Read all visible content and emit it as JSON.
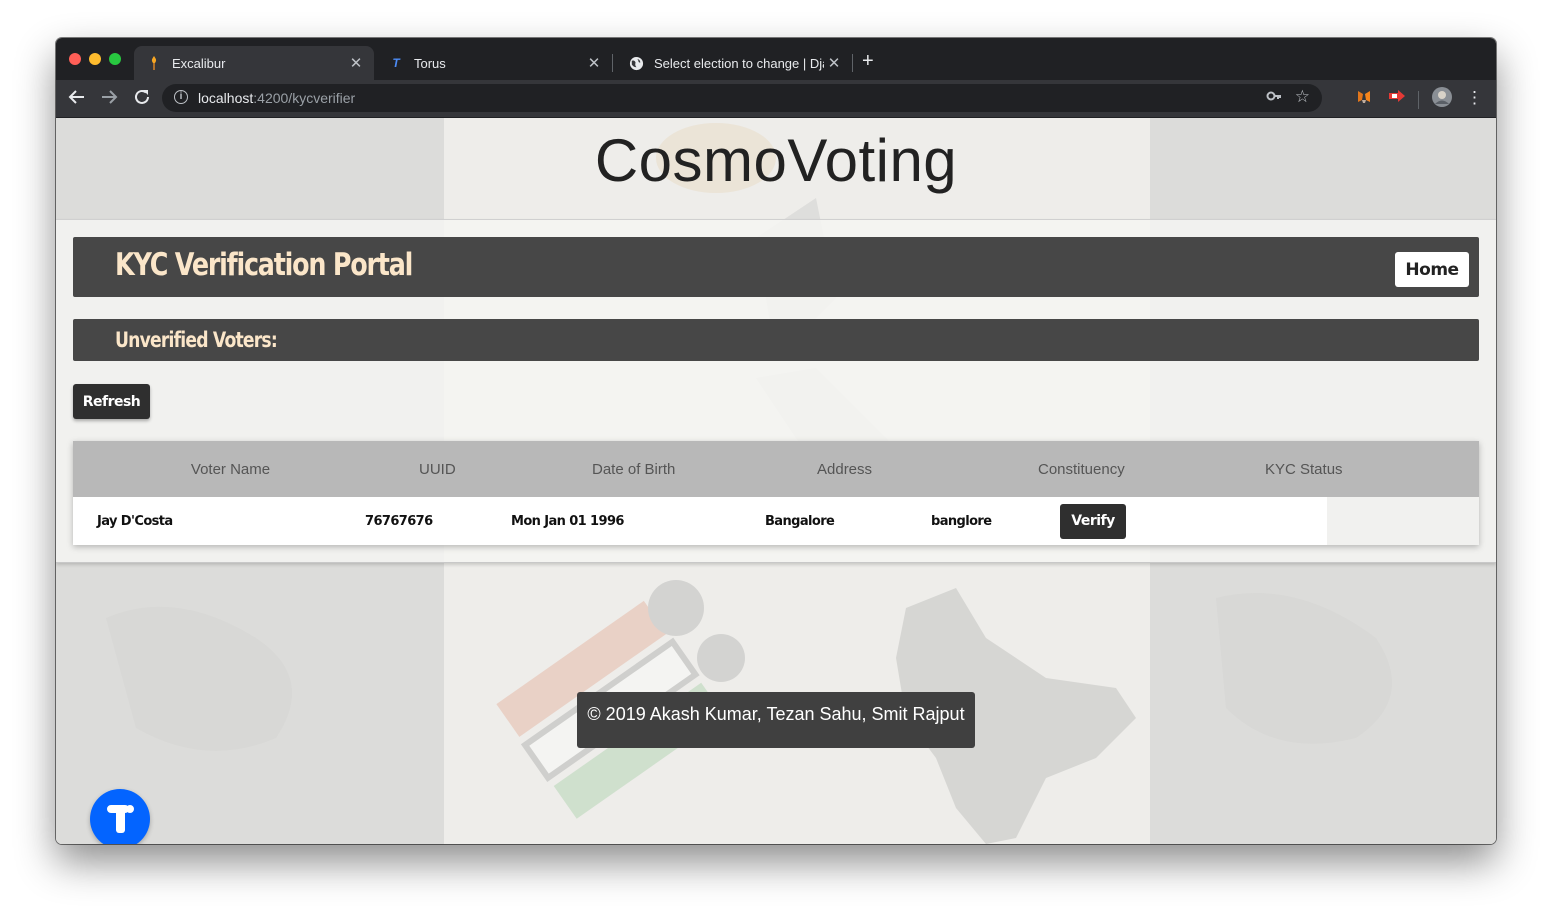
{
  "browser": {
    "tabs": [
      {
        "title": "Excalibur",
        "favicon": "torch-icon",
        "active": true
      },
      {
        "title": "Torus",
        "favicon": "torus-t-icon",
        "active": false
      },
      {
        "title": "Select election to change | Dja",
        "favicon": "globe-icon",
        "active": false
      }
    ],
    "url_host": "localhost",
    "url_path": ":4200/kycverifier"
  },
  "page": {
    "site_title": "CosmoVoting",
    "portal_title": "KYC Verification Portal",
    "home_label": "Home",
    "section_title": "Unverified Voters:",
    "refresh_label": "Refresh",
    "table": {
      "headers": [
        "Voter Name",
        "UUID",
        "Date of Birth",
        "Address",
        "Constituency",
        "KYC Status"
      ],
      "rows": [
        {
          "name": "Jay D'Costa",
          "uuid": "76767676",
          "dob": "Mon Jan 01 1996",
          "address": "Bangalore",
          "constituency": "banglore",
          "action": "Verify"
        }
      ]
    },
    "footer": "© 2019 Akash Kumar, Tezan Sahu, Smit Rajput"
  },
  "colors": {
    "bar_bg": "#474747",
    "heading_text": "#fbe6c9",
    "button_dark": "#2f2f2f",
    "torus_blue": "#0364ff"
  }
}
